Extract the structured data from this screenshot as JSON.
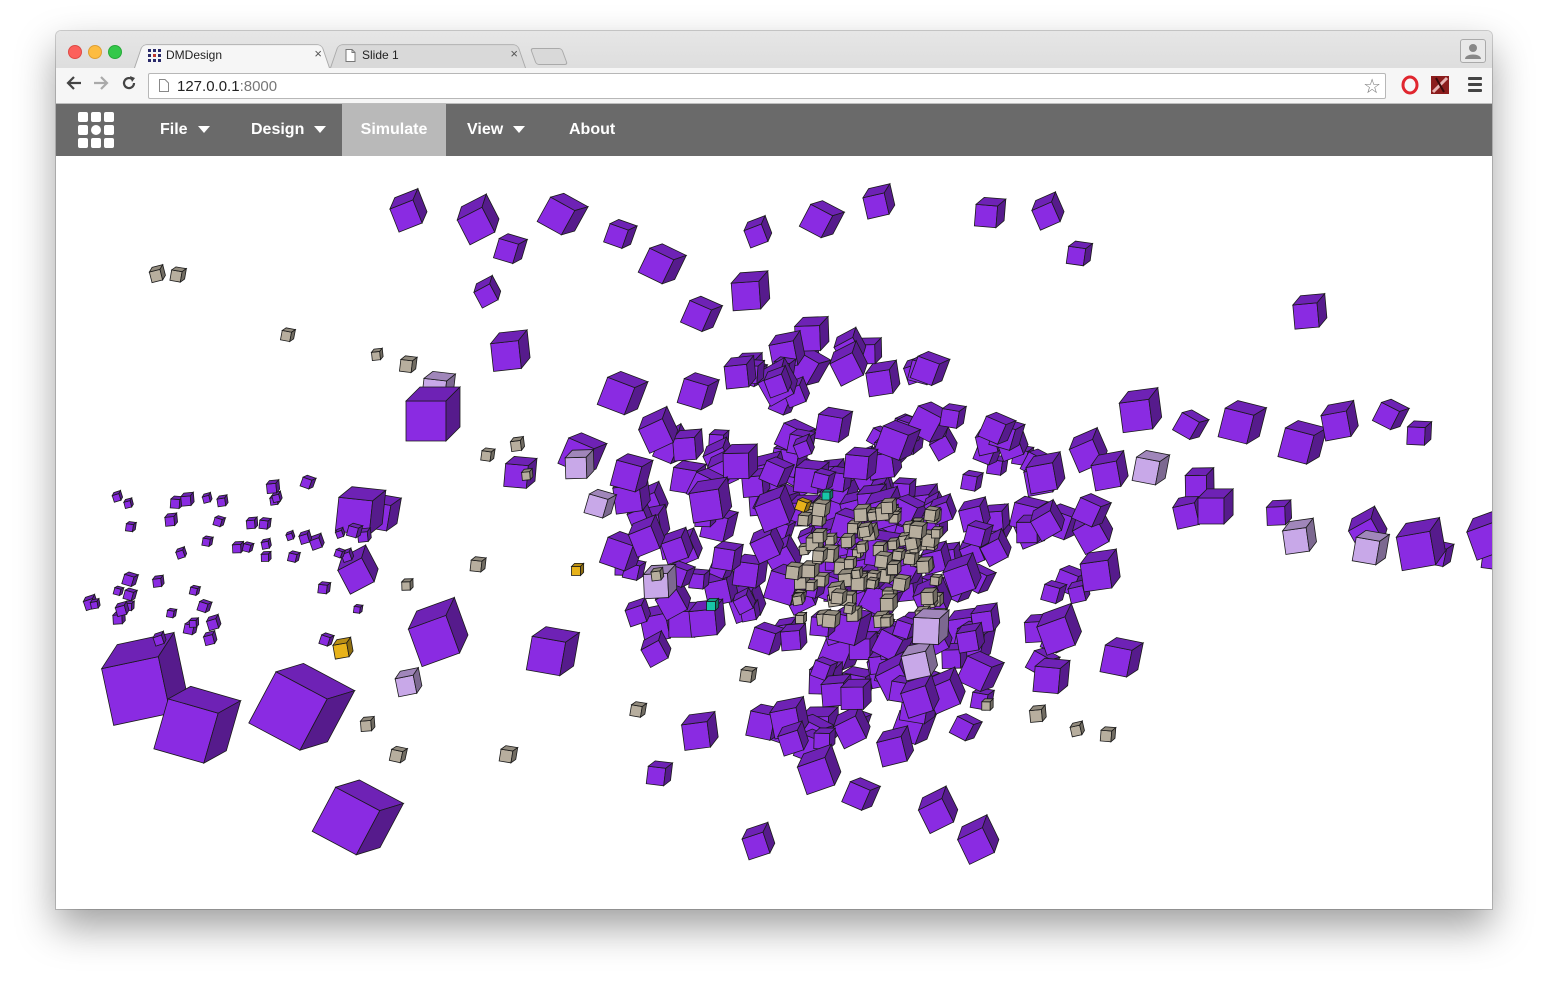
{
  "browser": {
    "tabs": [
      {
        "title": "DMDesign",
        "active": true,
        "close": "×"
      },
      {
        "title": "Slide 1",
        "active": false,
        "close": "×"
      }
    ],
    "url_host": "127.0.0.1",
    "url_port": ":8000"
  },
  "app_nav": {
    "items": [
      {
        "label": "File",
        "has_caret": true
      },
      {
        "label": "Design",
        "has_caret": true
      },
      {
        "label": "Simulate",
        "has_caret": false,
        "active": true
      },
      {
        "label": "View",
        "has_caret": true
      },
      {
        "label": "About",
        "has_caret": false
      }
    ]
  },
  "scene": {
    "colors": {
      "voxel_main": "#8a2be2",
      "voxel_light": "#c8a8e8",
      "voxel_gray": "#b7ae9e",
      "voxel_gold": "#e7b21a",
      "voxel_teal": "#18c7a8",
      "nav_bg": "#6a6a6a",
      "nav_active": "#b9b9b9"
    }
  }
}
